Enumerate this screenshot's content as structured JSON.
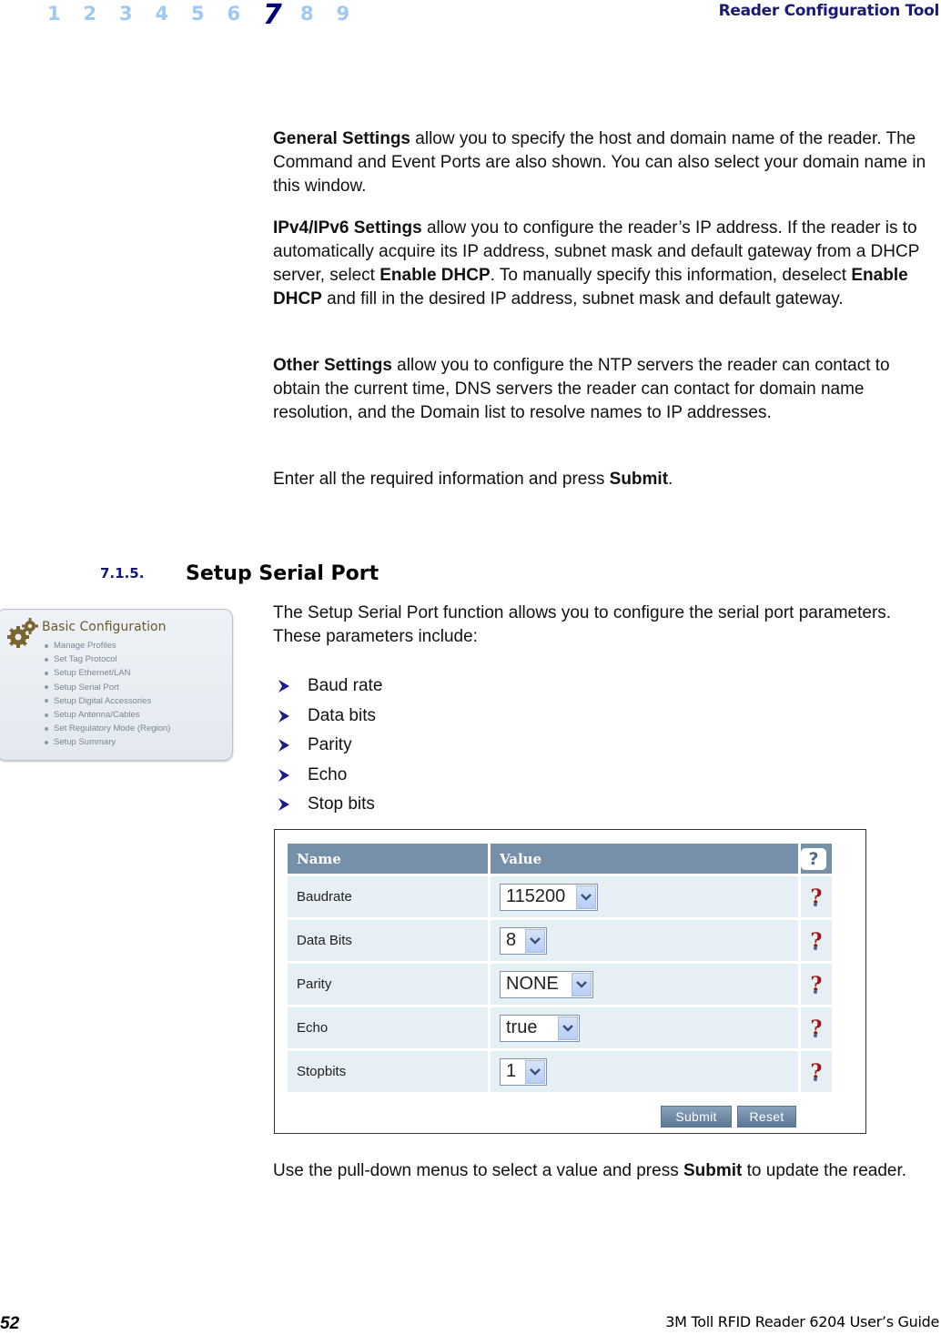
{
  "header": {
    "chapters": [
      "1",
      "2",
      "3",
      "4",
      "5",
      "6",
      "7",
      "8",
      "9"
    ],
    "active_chapter": "7",
    "title": "Reader Configuration Tool"
  },
  "intro": {
    "p1_bold": "General Settings",
    "p1_text": " allow you to specify the host and domain name of the reader. The Command and Event Ports are also shown. You can also select your domain name in this window.",
    "p2_bold": "IPv4/IPv6 Settings",
    "p2_text_a": " allow you to configure the reader’s IP address. If the reader is to automatically acquire its IP address, subnet mask and default gateway from a DHCP server, select ",
    "p2_bold_b": "Enable DHCP",
    "p2_text_b": ". To manually specify this information, deselect ",
    "p2_bold_c": "Enable DHCP",
    "p2_text_c": " and fill in the desired IP address, subnet mask and default gateway.",
    "p3_bold": "Other Settings",
    "p3_text": " allow you to configure the NTP servers the reader can contact to obtain the current time, DNS servers the reader can contact for domain name resolution, and the Domain list to resolve names to IP addresses.",
    "p4_text": "Enter all the required information and press ",
    "p4_bold": "Submit",
    "p4_end": "."
  },
  "section": {
    "number": "7.1.5.",
    "title": "Setup Serial Port",
    "intro": "The Setup Serial Port function allows you to configure the serial port parameters. These parameters include:",
    "bullets": [
      "Baud rate",
      "Data bits",
      "Parity",
      "Echo",
      "Stop bits"
    ],
    "outro_text": "Use the pull-down menus to select a value and press ",
    "outro_bold": "Submit",
    "outro_end": " to update the reader."
  },
  "sidebar_panel": {
    "title": "Basic Configuration",
    "items": [
      "Manage Profiles",
      "Set Tag Protocol",
      "Setup Ethernet/LAN",
      "Setup Serial Port",
      "Setup Digital Accessories",
      "Setup Antenna/Cables",
      "Set Regulatory Mode (Region)",
      "Setup Summary"
    ]
  },
  "serial_form": {
    "columns": [
      "Name",
      "Value",
      "?"
    ],
    "rows": [
      {
        "name": "Baudrate",
        "value": "115200"
      },
      {
        "name": "Data Bits",
        "value": "8"
      },
      {
        "name": "Parity",
        "value": "NONE"
      },
      {
        "name": "Echo",
        "value": "true"
      },
      {
        "name": "Stopbits",
        "value": "1"
      }
    ],
    "submit_label": "Submit",
    "reset_label": "Reset"
  },
  "footer": {
    "page_number": "52",
    "doc_title": "3M Toll RFID Reader 6204 User’s Guide"
  }
}
